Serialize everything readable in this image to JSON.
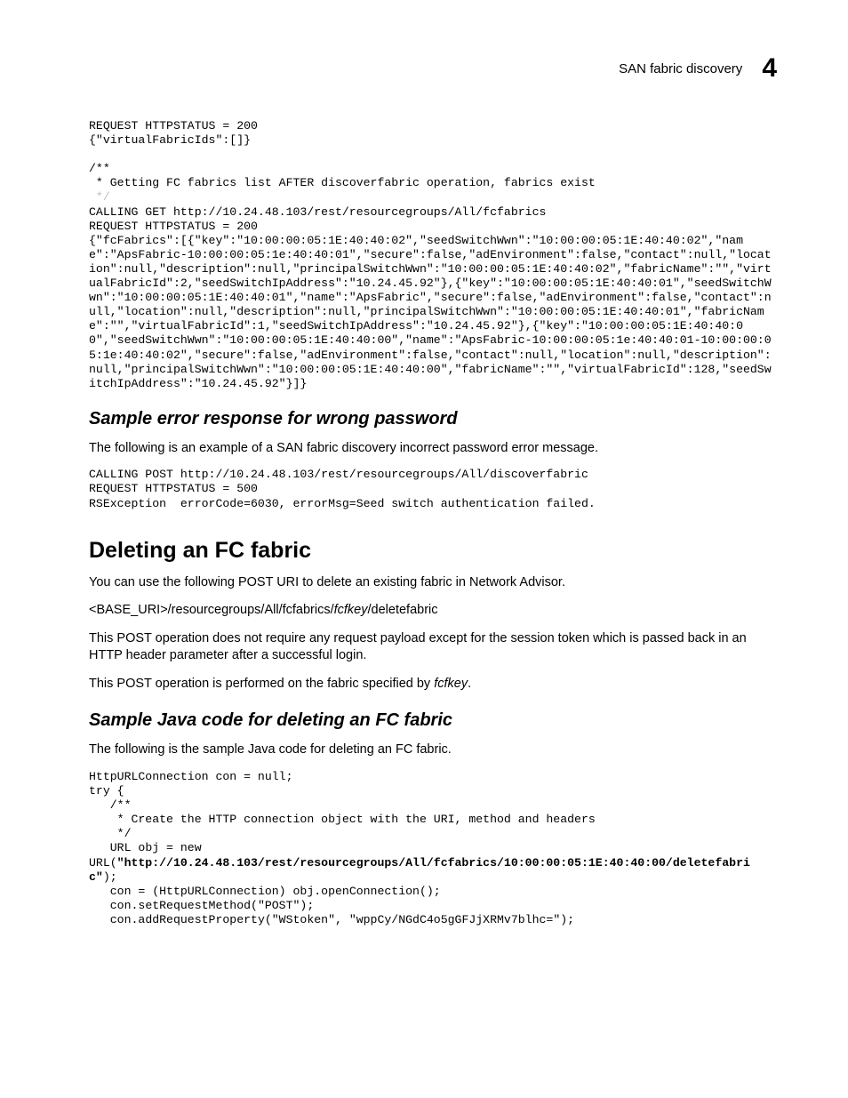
{
  "header": {
    "title": "SAN fabric discovery",
    "chapter": "4"
  },
  "code1": {
    "l1": "REQUEST HTTPSTATUS = 200",
    "l2": "{\"virtualFabricIds\":[]}",
    "l3": "",
    "l4": "/**",
    "l5": " * Getting FC fabrics list AFTER discoverfabric operation, fabrics exist",
    "l6": " */",
    "l7": "CALLING GET http://10.24.48.103/rest/resourcegroups/All/fcfabrics",
    "l8": "REQUEST HTTPSTATUS = 200",
    "l9": "{\"fcFabrics\":[{\"key\":\"10:00:00:05:1E:40:40:02\",\"seedSwitchWwn\":\"10:00:00:05:1E:40:40:02\",\"name\":\"ApsFabric-10:00:00:05:1e:40:40:01\",\"secure\":false,\"adEnvironment\":false,\"contact\":null,\"location\":null,\"description\":null,\"principalSwitchWwn\":\"10:00:00:05:1E:40:40:02\",\"fabricName\":\"\",\"virtualFabricId\":2,\"seedSwitchIpAddress\":\"10.24.45.92\"},{\"key\":\"10:00:00:05:1E:40:40:01\",\"seedSwitchWwn\":\"10:00:00:05:1E:40:40:01\",\"name\":\"ApsFabric\",\"secure\":false,\"adEnvironment\":false,\"contact\":null,\"location\":null,\"description\":null,\"principalSwitchWwn\":\"10:00:00:05:1E:40:40:01\",\"fabricName\":\"\",\"virtualFabricId\":1,\"seedSwitchIpAddress\":\"10.24.45.92\"},{\"key\":\"10:00:00:05:1E:40:40:00\",\"seedSwitchWwn\":\"10:00:00:05:1E:40:40:00\",\"name\":\"ApsFabric-10:00:00:05:1e:40:40:01-10:00:00:05:1e:40:40:02\",\"secure\":false,\"adEnvironment\":false,\"contact\":null,\"location\":null,\"description\":null,\"principalSwitchWwn\":\"10:00:00:05:1E:40:40:00\",\"fabricName\":\"\",\"virtualFabricId\":128,\"seedSwitchIpAddress\":\"10.24.45.92\"}]}"
  },
  "section1": {
    "heading": "Sample error response for wrong password",
    "intro": "The following is an example of a SAN fabric discovery incorrect password error message."
  },
  "code2": {
    "l1": "CALLING POST http://10.24.48.103/rest/resourcegroups/All/discoverfabric",
    "l2": "REQUEST HTTPSTATUS = 500",
    "l3": "RSException  errorCode=6030, errorMsg=Seed switch authentication failed."
  },
  "section2": {
    "heading": "Deleting an FC fabric",
    "p1": "You can use the following POST URI to delete an existing fabric in Network Advisor.",
    "p2_a": "<BASE_URI>/resourcegroups/All/fcfabrics/",
    "p2_b": "fcfkey",
    "p2_c": "/deletefabric",
    "p3": "This POST operation does not require any request payload except for the session token which is passed back in an HTTP header parameter after a successful login.",
    "p4_a": "This POST operation is performed on the fabric specified by ",
    "p4_b": "fcfkey",
    "p4_c": "."
  },
  "section3": {
    "heading": "Sample Java code for deleting an FC fabric",
    "intro": "The following is the sample Java code for deleting an FC fabric."
  },
  "code3": {
    "l1": "HttpURLConnection con = null;",
    "l2": "try {",
    "l3": "   /**",
    "l4": "    * Create the HTTP connection object with the URI, method and headers",
    "l5": "    */",
    "l6": "   URL obj = new ",
    "l7a": "URL(",
    "l7b": "\"http://10.24.48.103/rest/resourcegroups/All/fcfabrics/10:00:00:05:1E:40:40:00/deletefabric\"",
    "l7c": ");",
    "l8": "   con = (HttpURLConnection) obj.openConnection();",
    "l9": "   con.setRequestMethod(\"POST\");",
    "l10": "   con.addRequestProperty(\"WStoken\", \"wppCy/NGdC4o5gGFJjXRMv7blhc=\");"
  }
}
